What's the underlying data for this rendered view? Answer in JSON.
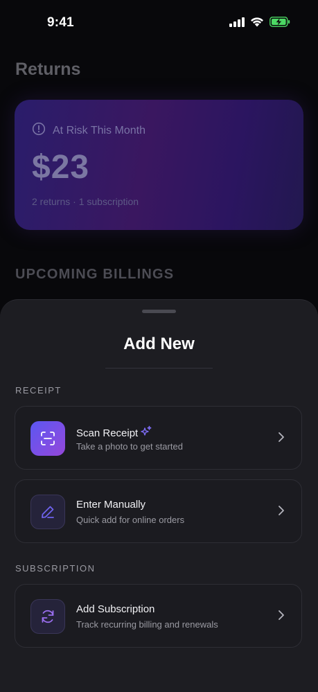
{
  "status_bar": {
    "time": "9:41"
  },
  "background": {
    "page_title": "Returns",
    "risk_card": {
      "label": "At Risk This Month",
      "amount": "$23",
      "summary": "2 returns · 1 subscription"
    },
    "upcoming_heading": "UPCOMING BILLINGS"
  },
  "sheet": {
    "title": "Add New",
    "receipt_section": {
      "label": "RECEIPT",
      "options": [
        {
          "title": "Scan Receipt",
          "subtitle": "Take a photo to get started",
          "icon": "scan-icon"
        },
        {
          "title": "Enter Manually",
          "subtitle": "Quick add for online orders",
          "icon": "pencil-icon"
        }
      ]
    },
    "subscription_section": {
      "label": "SUBSCRIPTION",
      "options": [
        {
          "title": "Add Subscription",
          "subtitle": "Track recurring billing and renewals",
          "icon": "refresh-icon"
        }
      ]
    }
  },
  "colors": {
    "accent_start": "#5b57f0",
    "accent_end": "#9447d8",
    "sheet_bg": "#1d1d22",
    "battery": "#4cd964"
  }
}
